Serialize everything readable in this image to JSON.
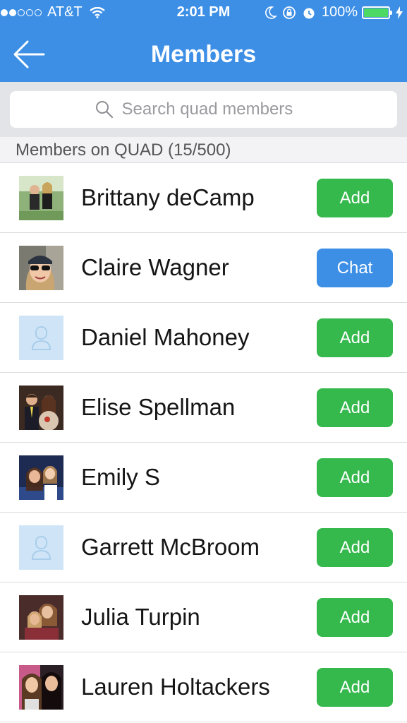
{
  "status_bar": {
    "carrier": "AT&T",
    "time": "2:01 PM",
    "battery": "100%",
    "signal_bars_filled": 2,
    "signal_bars_total": 5
  },
  "nav": {
    "title": "Members",
    "back_icon": "arrow-left-icon"
  },
  "search": {
    "placeholder": "Search quad members",
    "value": ""
  },
  "section": {
    "label": "Members on QUAD (15/500)"
  },
  "members": [
    {
      "name": "Brittany deCamp",
      "action": "Add",
      "has_photo": true
    },
    {
      "name": "Claire Wagner",
      "action": "Chat",
      "has_photo": true
    },
    {
      "name": "Daniel Mahoney",
      "action": "Add",
      "has_photo": false
    },
    {
      "name": "Elise Spellman",
      "action": "Add",
      "has_photo": true
    },
    {
      "name": "Emily S",
      "action": "Add",
      "has_photo": true
    },
    {
      "name": "Garrett McBroom",
      "action": "Add",
      "has_photo": false
    },
    {
      "name": "Julia Turpin",
      "action": "Add",
      "has_photo": true
    },
    {
      "name": "Lauren Holtackers",
      "action": "Add",
      "has_photo": true
    }
  ],
  "colors": {
    "header_blue": "#3d8fe6",
    "add_green": "#35b84c",
    "chat_blue": "#3d8fe6",
    "battery_green": "#4cd964"
  }
}
